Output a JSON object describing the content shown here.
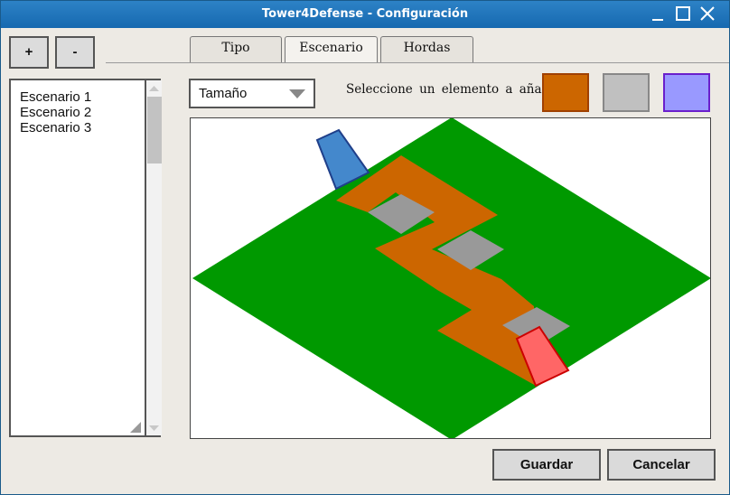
{
  "window": {
    "title": "Tower4Defense - Configuración"
  },
  "toolbar": {
    "add_label": "+",
    "remove_label": "-"
  },
  "tabs": [
    {
      "label": "Tipo",
      "active": false
    },
    {
      "label": "Escenario",
      "active": true
    },
    {
      "label": "Hordas",
      "active": false
    }
  ],
  "scenarios": {
    "items": [
      "Escenario 1",
      "Escenario 2",
      "Escenario 3"
    ]
  },
  "size_select": {
    "selected": "Tamaño"
  },
  "element_picker": {
    "label": "Seleccione un elemento a añadir",
    "swatches": [
      {
        "name": "path",
        "color": "#cc6600"
      },
      {
        "name": "block",
        "color": "#c0c0c0"
      },
      {
        "name": "special",
        "color": "#9999ff"
      }
    ]
  },
  "map_canvas": {
    "grass_color": "#009900",
    "path_color": "#cc6600",
    "block_color": "#999999",
    "start_marker_color": "#4488cc",
    "end_marker_color": "#ff6666"
  },
  "actions": {
    "save_label": "Guardar",
    "cancel_label": "Cancelar"
  },
  "icons": {
    "minimize": "minimize-icon",
    "maximize": "maximize-icon",
    "close": "close-icon",
    "dropdown": "chevron-down-icon",
    "scroll_up": "arrow-up-icon",
    "scroll_down": "arrow-down-icon",
    "resize": "resize-grip-icon"
  }
}
